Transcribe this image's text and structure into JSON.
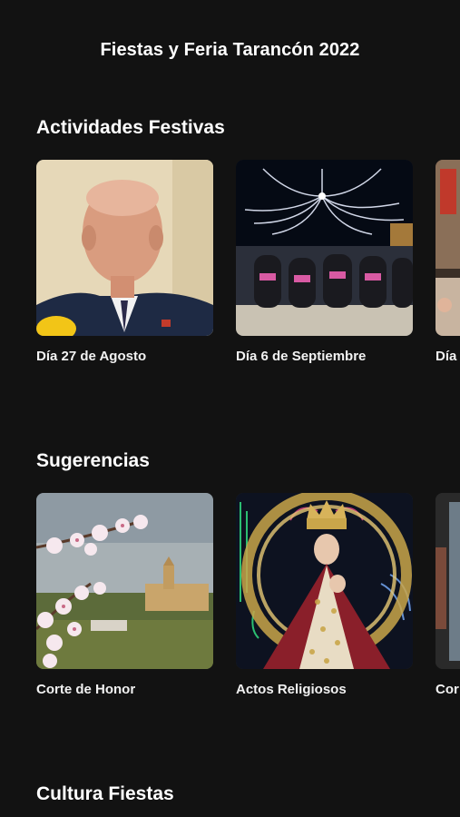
{
  "header": {
    "title": "Fiestas y Feria Tarancón 2022"
  },
  "sections": [
    {
      "title": "Actividades Festivas",
      "cards": [
        {
          "label": "Día 27 de Agosto",
          "image": "elderly-man-interview-photo"
        },
        {
          "label": "Día 6 de Septiembre",
          "image": "festival-lights-night-photo"
        },
        {
          "label": "Día",
          "image": "street-crowd-photo"
        }
      ]
    },
    {
      "title": "Sugerencias",
      "cards": [
        {
          "label": "Corte de Honor",
          "image": "almond-blossom-town-photo"
        },
        {
          "label": "Actos Religiosos",
          "image": "virgin-statue-photo"
        },
        {
          "label": "Cor",
          "image": "poster-photo"
        }
      ]
    },
    {
      "title": "Cultura Fiestas"
    }
  ],
  "colors": {
    "background": "#121212",
    "text": "#ffffff"
  }
}
